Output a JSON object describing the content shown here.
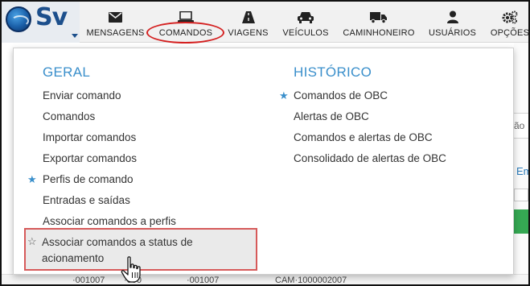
{
  "brand": {
    "text": "Sv",
    "logo_icon": "globe-logo-icon"
  },
  "navbar": {
    "items": [
      {
        "key": "mensagens",
        "label": "MENSAGENS",
        "icon": "envelope-icon"
      },
      {
        "key": "comandos",
        "label": "COMANDOS",
        "icon": "laptop-icon",
        "active": true
      },
      {
        "key": "viagens",
        "label": "VIAGENS",
        "icon": "road-icon"
      },
      {
        "key": "veiculos",
        "label": "VEÍCULOS",
        "icon": "car-icon"
      },
      {
        "key": "caminhoneiro",
        "label": "CAMINHONEIRO",
        "icon": "truck-icon"
      },
      {
        "key": "usuarios",
        "label": "USUÁRIOS",
        "icon": "user-icon"
      },
      {
        "key": "opcoes",
        "label": "OPÇÕES",
        "icon": "cogs-icon"
      }
    ]
  },
  "menu": {
    "geral": {
      "heading": "GERAL",
      "items": [
        {
          "label": "Enviar comando",
          "star": "none"
        },
        {
          "label": "Comandos",
          "star": "none"
        },
        {
          "label": "Importar comandos",
          "star": "none"
        },
        {
          "label": "Exportar comandos",
          "star": "none"
        },
        {
          "label": "Perfis de comando",
          "star": "filled"
        },
        {
          "label": "Entradas e saídas",
          "star": "none"
        },
        {
          "label": "Associar comandos a perfis",
          "star": "none"
        },
        {
          "label": "Associar comandos a status de acionamento",
          "star": "outline",
          "hovered": true
        }
      ]
    },
    "historico": {
      "heading": "HISTÓRICO",
      "items": [
        {
          "label": "Comandos de OBC",
          "star": "filled"
        },
        {
          "label": "Alertas de OBC",
          "star": "none"
        },
        {
          "label": "Comandos e alertas de OBC",
          "star": "none"
        },
        {
          "label": "Consolidado de alertas de OBC",
          "star": "none"
        }
      ]
    }
  },
  "background": {
    "cell_text": "ão",
    "link_text": "Emi",
    "bottom_row": [
      "·001007",
      "·000",
      "·001007",
      "CAM·1000002007"
    ]
  },
  "colors": {
    "accent": "#3a8fcb",
    "highlight_red": "#d42020",
    "selected_border": "#d65a5a",
    "brand_blue": "#1c4f8c"
  }
}
